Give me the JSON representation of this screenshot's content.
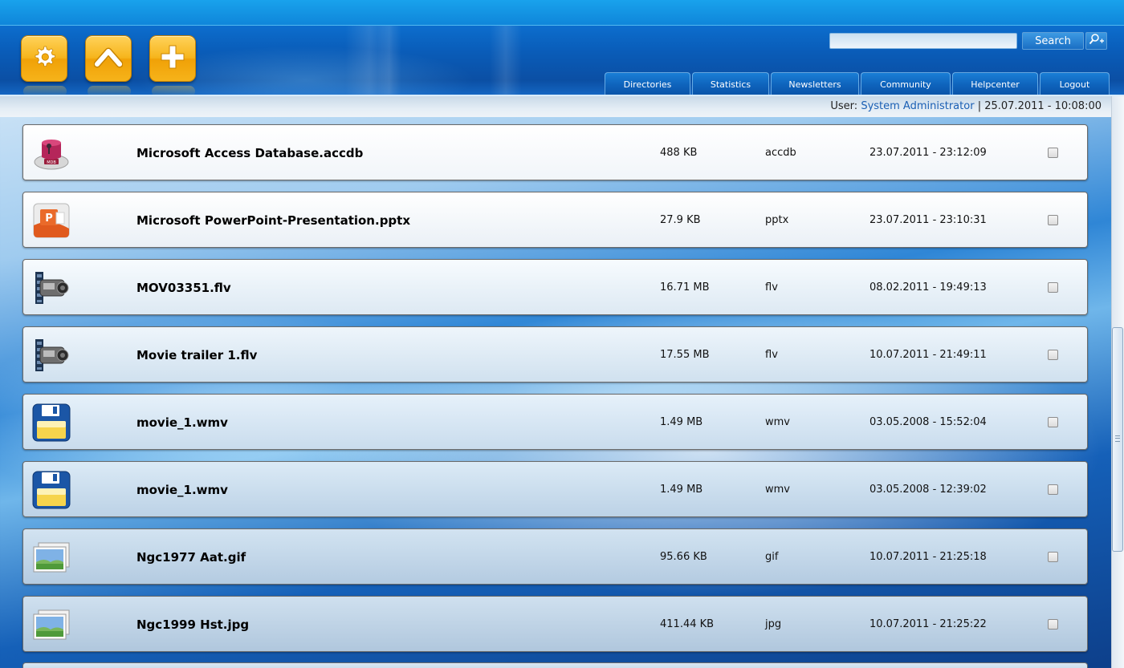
{
  "header": {
    "buttons": [
      {
        "name": "settings",
        "icon": "gear-icon"
      },
      {
        "name": "up",
        "icon": "chevron-up-icon"
      },
      {
        "name": "add",
        "icon": "plus-icon"
      }
    ],
    "search": {
      "value": "",
      "placeholder": "",
      "button_label": "Search",
      "advanced_icon": "search-plus-icon"
    },
    "nav": [
      {
        "label": "Directories"
      },
      {
        "label": "Statistics"
      },
      {
        "label": "Newsletters"
      },
      {
        "label": "Community"
      },
      {
        "label": "Helpcenter"
      },
      {
        "label": "Logout"
      }
    ]
  },
  "user_bar": {
    "prefix": "User:",
    "name": "System Administrator",
    "separator": "|",
    "datetime": "25.07.2011 - 10:08:00"
  },
  "files": [
    {
      "name": "Microsoft Access Database.accdb",
      "size": "488 KB",
      "type": "accdb",
      "date": "23.07.2011 - 23:12:09",
      "icon": "access-database-icon",
      "checked": false
    },
    {
      "name": "Microsoft PowerPoint-Presentation.pptx",
      "size": "27.9 KB",
      "type": "pptx",
      "date": "23.07.2011 - 23:10:31",
      "icon": "powerpoint-icon",
      "checked": false
    },
    {
      "name": "MOV03351.flv",
      "size": "16.71 MB",
      "type": "flv",
      "date": "08.02.2011 - 19:49:13",
      "icon": "video-camera-icon",
      "checked": false
    },
    {
      "name": "Movie trailer 1.flv",
      "size": "17.55 MB",
      "type": "flv",
      "date": "10.07.2011 - 21:49:11",
      "icon": "video-camera-icon",
      "checked": false
    },
    {
      "name": "movie_1.wmv",
      "size": "1.49 MB",
      "type": "wmv",
      "date": "03.05.2008 - 15:52:04",
      "icon": "floppy-disk-icon",
      "checked": false
    },
    {
      "name": "movie_1.wmv",
      "size": "1.49 MB",
      "type": "wmv",
      "date": "03.05.2008 - 12:39:02",
      "icon": "floppy-disk-icon",
      "checked": false
    },
    {
      "name": "Ngc1977 Aat.gif",
      "size": "95.66 KB",
      "type": "gif",
      "date": "10.07.2011 - 21:25:18",
      "icon": "image-icon",
      "checked": false
    },
    {
      "name": "Ngc1999 Hst.jpg",
      "size": "411.44 KB",
      "type": "jpg",
      "date": "10.07.2011 - 21:25:22",
      "icon": "image-icon",
      "checked": false
    }
  ],
  "colors": {
    "accent_orange": "#f6b31a",
    "header_blue": "#0b5cb8",
    "link_blue": "#1a5fb4"
  }
}
